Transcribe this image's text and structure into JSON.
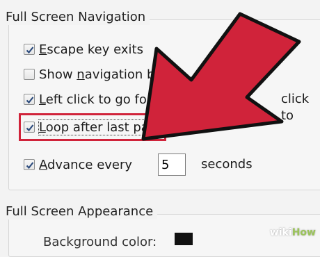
{
  "dialog": {
    "navigation_group": {
      "title": "Full Screen Navigation",
      "escape_key": {
        "label_pre": "",
        "underline": "E",
        "label_post": "scape key exits",
        "checked": true
      },
      "show_nav_bar": {
        "label_pre": "Show ",
        "underline": "n",
        "label_post": "avigation bar",
        "checked": false
      },
      "left_click": {
        "label_pre": "",
        "underline": "L",
        "label_post": "eft click to go for",
        "tail": "click to",
        "checked": true
      },
      "loop": {
        "label_pre": "",
        "underline": "L",
        "label_post": "oop after last page",
        "checked": true
      },
      "advance": {
        "label_pre": "",
        "underline": "A",
        "label_post": "dvance every",
        "checked": true,
        "seconds_value": "5",
        "seconds_label": "seconds"
      }
    },
    "appearance_group": {
      "title": "Full Screen Appearance",
      "background_label": "Background color:"
    }
  },
  "annotation": {
    "arrow_color": "#d0233a",
    "highlight_color": "#d0233a"
  },
  "watermark": {
    "wiki": "wiki",
    "how": "How"
  }
}
